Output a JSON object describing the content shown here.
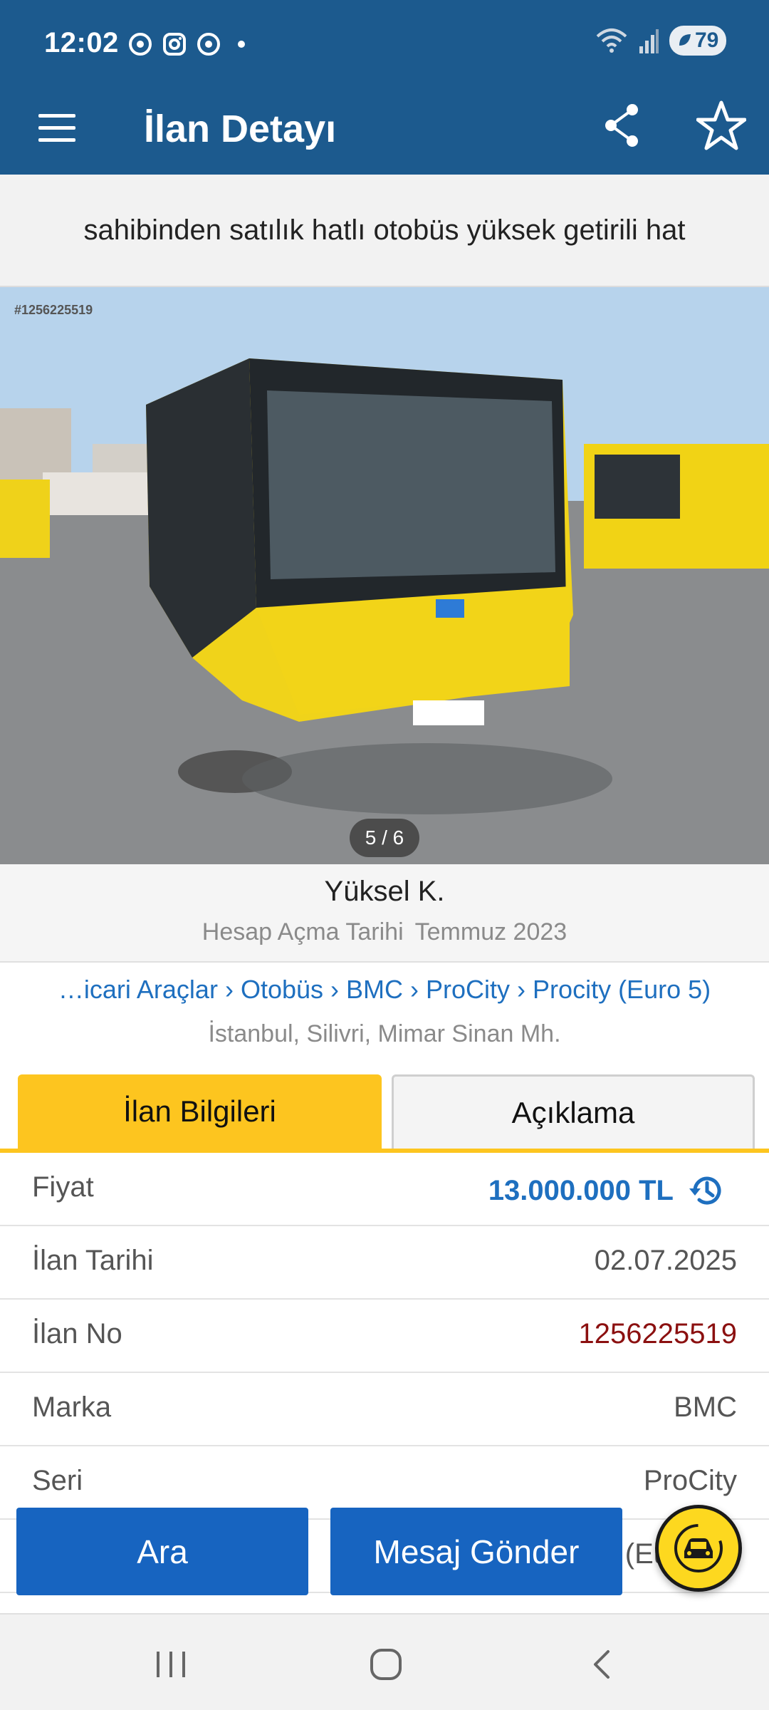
{
  "status_bar": {
    "time": "12:02",
    "battery": "79",
    "icons": [
      "chrome-icon",
      "instagram-icon",
      "chrome-icon",
      "notification-dot",
      "wifi-icon",
      "signal-icon",
      "battery-icon"
    ]
  },
  "toolbar": {
    "title": "İlan Detayı",
    "color": "#1c5a8e"
  },
  "ad": {
    "title": "sahibinden satılık hatlı otobüs yüksek getirili hat",
    "photo_id": "#1256225519",
    "photo_counter": "5 / 6"
  },
  "seller": {
    "name": "Yüksel K.",
    "since_label": "Hesap Açma Tarihi",
    "since_value": "Temmuz 2023"
  },
  "breadcrumb": {
    "items": [
      "…icari Araçlar",
      "Otobüs",
      "BMC",
      "ProCity",
      "Procity (Euro 5)"
    ],
    "location": "İstanbul, Silivri, Mimar Sinan Mh."
  },
  "tabs": {
    "info": "İlan Bilgileri",
    "description": "Açıklama",
    "accent": "#fdc51f"
  },
  "details": {
    "rows": [
      {
        "label": "Fiyat",
        "value": "13.000.000 TL"
      },
      {
        "label": "İlan Tarihi",
        "value": "02.07.2025"
      },
      {
        "label": "İlan No",
        "value": "1256225519"
      },
      {
        "label": "Marka",
        "value": "BMC"
      },
      {
        "label": "Seri",
        "value": "ProCity"
      },
      {
        "label": "",
        "value": "(Eu"
      }
    ]
  },
  "actions": {
    "call": "Ara",
    "message": "Mesaj Gönder",
    "button_color": "#1764c0"
  }
}
